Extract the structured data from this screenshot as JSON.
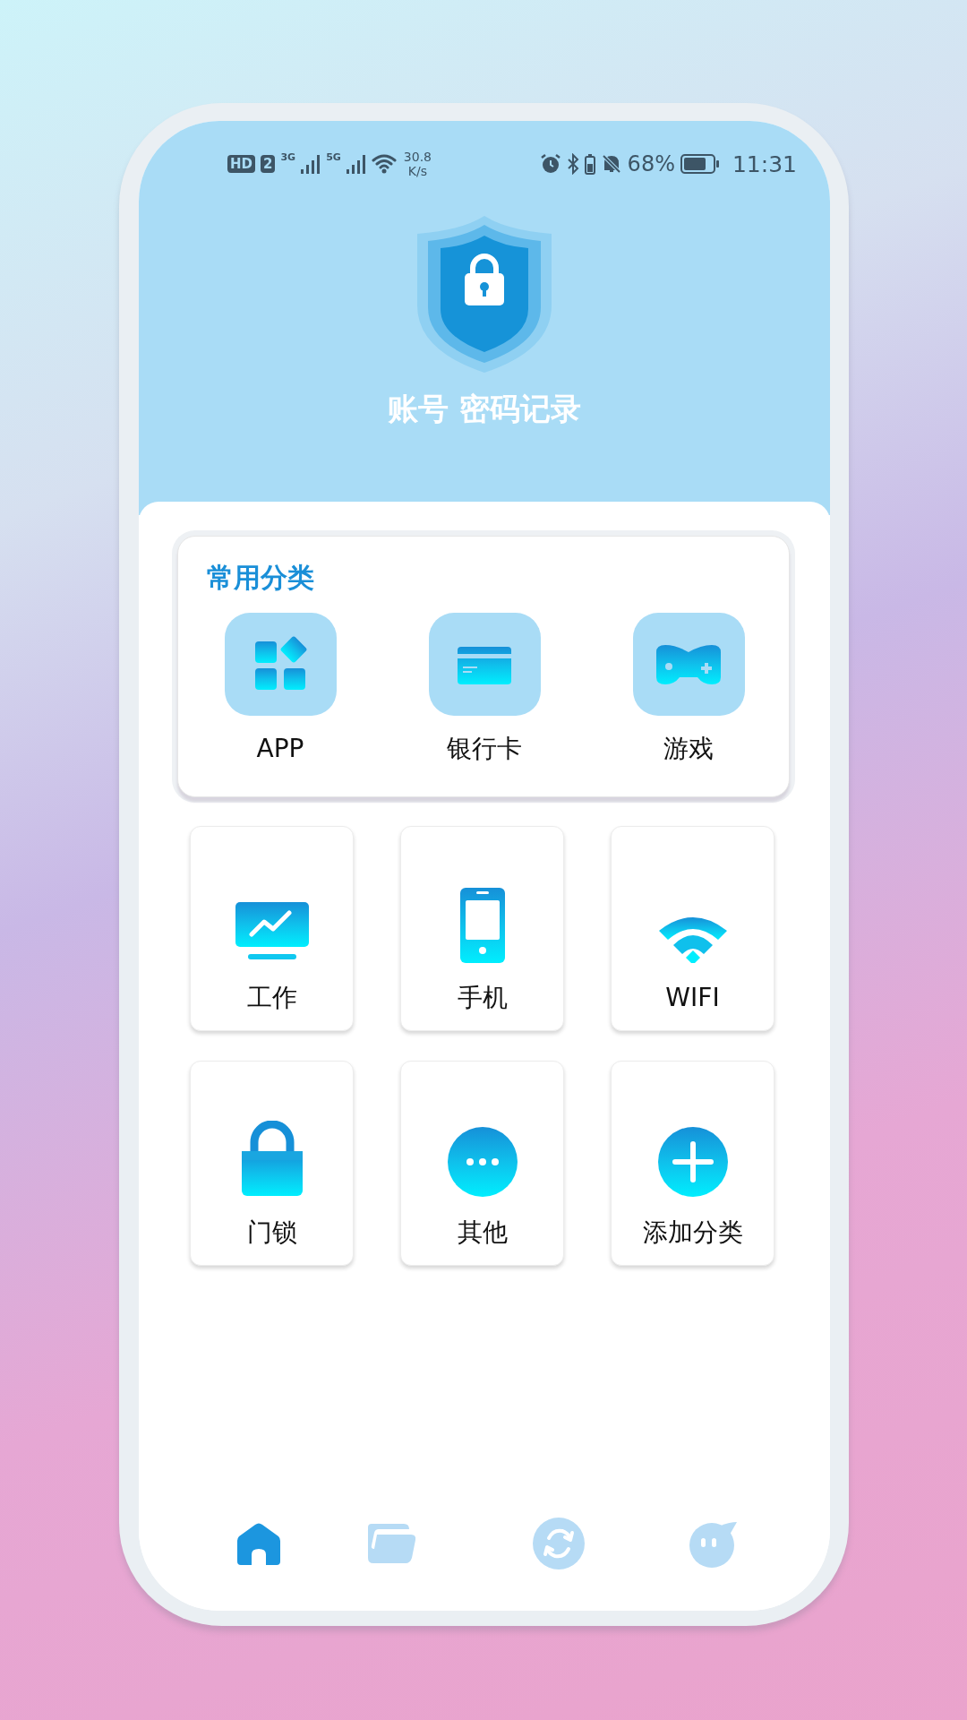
{
  "status_bar": {
    "hd": "HD",
    "sim": "2",
    "network_1": "3G",
    "network_2": "5G",
    "speed_value": "30.8",
    "speed_unit": "K/s",
    "battery": "68%",
    "time": "11:31"
  },
  "header": {
    "title": "账号 密码记录"
  },
  "common_categories": {
    "title": "常用分类",
    "items": [
      {
        "label": "APP",
        "kind": "apps"
      },
      {
        "label": "银行卡",
        "kind": "card"
      },
      {
        "label": "游戏",
        "kind": "gamepad"
      }
    ]
  },
  "categories": [
    {
      "label": "工作",
      "kind": "monitor"
    },
    {
      "label": "手机",
      "kind": "phone"
    },
    {
      "label": "WIFI",
      "kind": "wifi"
    },
    {
      "label": "门锁",
      "kind": "lock"
    },
    {
      "label": "其他",
      "kind": "more"
    },
    {
      "label": "添加分类",
      "kind": "add"
    }
  ],
  "bottom_nav": [
    {
      "kind": "home",
      "selected": true
    },
    {
      "kind": "folder",
      "selected": false
    },
    {
      "kind": "sync",
      "selected": false
    },
    {
      "kind": "chat",
      "selected": false
    }
  ]
}
